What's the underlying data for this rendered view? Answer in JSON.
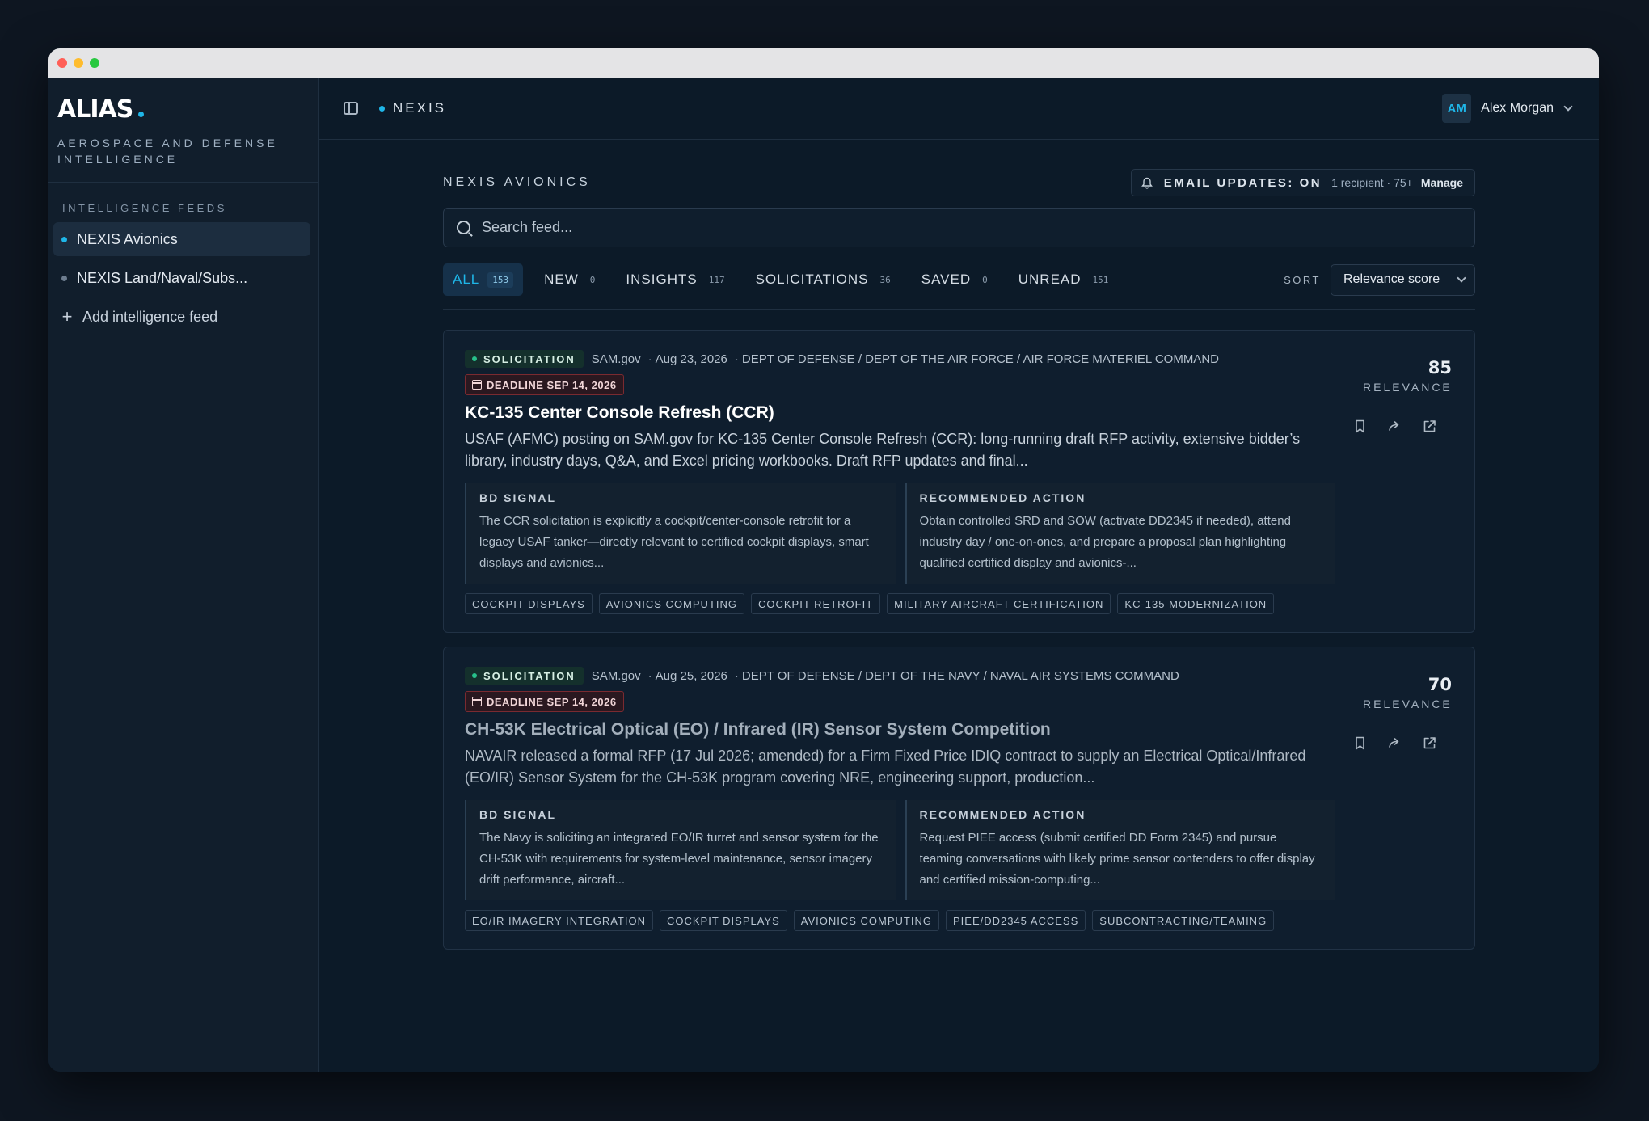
{
  "brand": {
    "name": "ALIAS",
    "subtitle": "AEROSPACE AND DEFENSE INTELLIGENCE"
  },
  "sidebar": {
    "section_label": "INTELLIGENCE FEEDS",
    "items": [
      {
        "label": "NEXIS Avionics",
        "active": true
      },
      {
        "label": "NEXIS Land/Naval/Subs..."
      }
    ],
    "add_label": "Add intelligence feed"
  },
  "topbar": {
    "breadcrumb": "NEXIS",
    "user_initials": "AM",
    "user_name": "Alex Morgan"
  },
  "feed": {
    "title": "NEXIS AVIONICS",
    "email": {
      "label": "EMAIL UPDATES: ON",
      "meta": "1 recipient · 75+",
      "manage": "Manage"
    },
    "search_placeholder": "Search feed...",
    "tabs": [
      {
        "label": "ALL",
        "count": "153",
        "active": true
      },
      {
        "label": "NEW",
        "count": "0"
      },
      {
        "label": "INSIGHTS",
        "count": "117"
      },
      {
        "label": "SOLICITATIONS",
        "count": "36"
      },
      {
        "label": "SAVED",
        "count": "0"
      },
      {
        "label": "UNREAD",
        "count": "151"
      }
    ],
    "sort_label": "SORT",
    "sort_value": "Relevance score"
  },
  "cards": [
    {
      "type": "SOLICITATION",
      "source": "SAM.gov",
      "date": "Aug 23, 2026",
      "agency": "DEPT OF DEFENSE  / DEPT OF THE AIR FORCE  / AIR FORCE MATERIEL COMMAND",
      "deadline": "DEADLINE SEP 14, 2026",
      "title": "KC-135 Center Console Refresh (CCR)",
      "description": "USAF (AFMC) posting on SAM.gov for KC-135 Center Console Refresh (CCR): long-running draft RFP activity, extensive bidder’s library, industry days, Q&A, and Excel pricing workbooks. Draft RFP updates and final...",
      "bd_signal_label": "BD SIGNAL",
      "bd_signal": "The CCR solicitation is explicitly a cockpit/center-console retrofit for a legacy USAF tanker—directly relevant to certified cockpit displays, smart displays and avionics...",
      "action_label": "RECOMMENDED ACTION",
      "action": "Obtain controlled SRD and SOW (activate DD2345 if needed), attend industry day / one-on-ones, and prepare a proposal plan highlighting qualified certified display and avionics-...",
      "tags": [
        "COCKPIT DISPLAYS",
        "AVIONICS COMPUTING",
        "COCKPIT RETROFIT",
        "MILITARY AIRCRAFT CERTIFICATION",
        "KC-135 MODERNIZATION"
      ],
      "score": "85",
      "score_label": "RELEVANCE"
    },
    {
      "type": "SOLICITATION",
      "source": "SAM.gov",
      "date": "Aug 25, 2026",
      "agency": "DEPT OF DEFENSE  / DEPT OF THE NAVY  / NAVAL AIR SYSTEMS COMMAND",
      "deadline": "DEADLINE SEP 14, 2026",
      "title": "CH-53K Electrical Optical (EO) / Infrared (IR) Sensor System Competition",
      "description": "NAVAIR released a formal RFP (17 Jul 2026; amended)  for a Firm Fixed Price IDIQ contract to supply an Electrical Optical/Infrared (EO/IR) Sensor System for the CH-53K program covering NRE, engineering support, production...",
      "bd_signal_label": "BD SIGNAL",
      "bd_signal": "The Navy is soliciting an integrated EO/IR turret and sensor system for the CH-53K with requirements for system-level maintenance, sensor imagery drift performance, aircraft...",
      "action_label": "RECOMMENDED ACTION",
      "action": "Request PIEE access (submit certified DD Form 2345)  and pursue teaming conversations with likely prime sensor contenders to offer display and certified mission-computing...",
      "tags": [
        "EO/IR IMAGERY INTEGRATION",
        "COCKPIT DISPLAYS",
        "AVIONICS COMPUTING",
        "PIEE/DD2345 ACCESS",
        "SUBCONTRACTING/TEAMING"
      ],
      "score": "70",
      "score_label": "RELEVANCE"
    }
  ]
}
